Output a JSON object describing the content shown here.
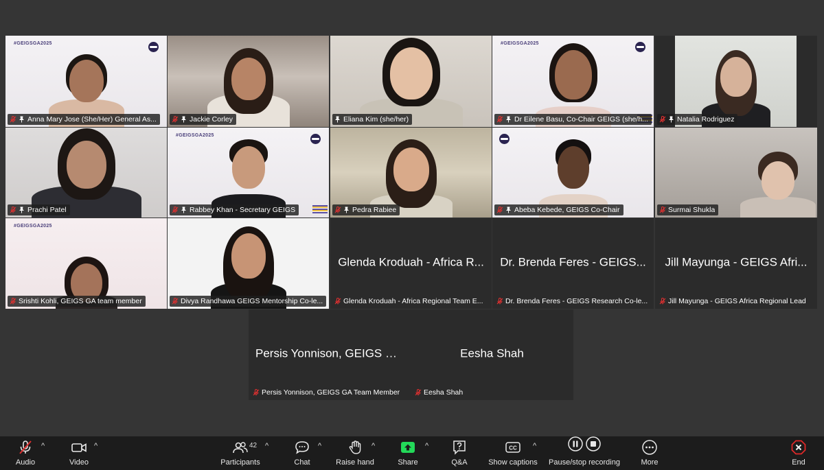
{
  "participants": [
    {
      "name": "Anna Mary Jose (She/Her) General As...",
      "hashtag": "#GEIGSGA2025"
    },
    {
      "name": "Jackie Corley"
    },
    {
      "name": "Eliana Kim (she/her)"
    },
    {
      "name": "Dr Eilene Basu, Co-Chair GEIGS (she/h...",
      "hashtag": "#GEIGSGA2025"
    },
    {
      "name": "Natalia Rodriguez"
    },
    {
      "name": "Prachi Patel"
    },
    {
      "name": "Rabbey Khan - Secretary GEIGS",
      "hashtag": "#GEIGSGA2025"
    },
    {
      "name": "Pedra Rabiee"
    },
    {
      "name": "Abeba Kebede, GEIGS Co-Chair"
    },
    {
      "name": "Surmai Shukla"
    },
    {
      "name": "Srishti Kohli, GEIGS GA team member",
      "hashtag": "#GEIGSGA2025"
    },
    {
      "name": "Divya Randhawa GEIGS Mentorship Co-le..."
    },
    {
      "name": "Glenda Kroduah - Africa Regional Team E...",
      "display": "Glenda Kroduah - Africa R..."
    },
    {
      "name": "Dr. Brenda Feres - GEIGS Research Co-le...",
      "display": "Dr. Brenda Feres - GEIGS..."
    },
    {
      "name": "Jill Mayunga -  GEIGS Africa Regional Lead",
      "display": "Jill Mayunga -  GEIGS Afri..."
    },
    {
      "name": "Persis Yonnison, GEIGS GA Team Member",
      "display": "Persis Yonnison, GEIGS G..."
    },
    {
      "name": "Eesha Shah",
      "display": "Eesha Shah"
    }
  ],
  "toolbar": {
    "audio": "Audio",
    "video": "Video",
    "participants": "Participants",
    "participant_count": "42",
    "chat": "Chat",
    "raise_hand": "Raise hand",
    "share": "Share",
    "qa": "Q&A",
    "captions": "Show captions",
    "captions_badge": "CC",
    "recording": "Pause/stop recording",
    "more": "More",
    "end": "End"
  },
  "colors": {
    "active_speaker_border": "#23d959",
    "share_green": "#23d959",
    "end_red": "#e02828"
  }
}
